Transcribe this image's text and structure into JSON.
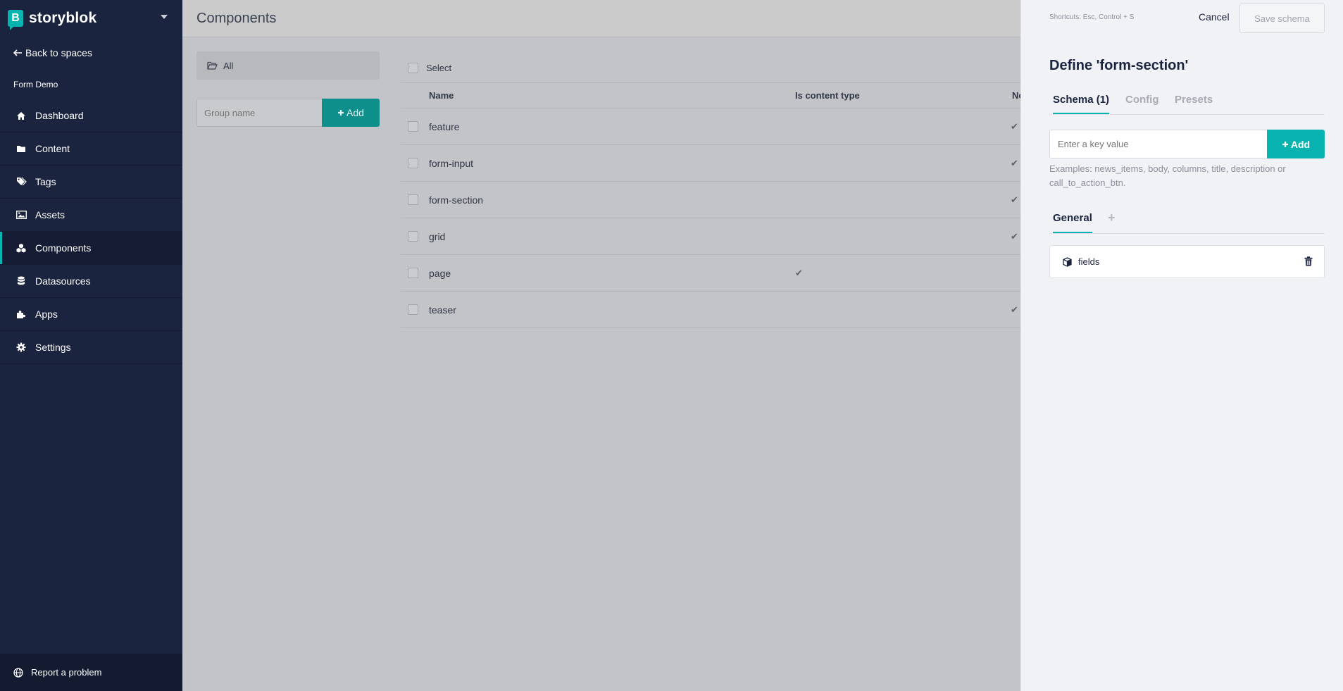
{
  "sidebar": {
    "brand": "storyblok",
    "back_label": "Back to spaces",
    "space_name": "Form Demo",
    "nav": [
      {
        "label": "Dashboard",
        "icon": "home-icon"
      },
      {
        "label": "Content",
        "icon": "folder-icon"
      },
      {
        "label": "Tags",
        "icon": "tags-icon"
      },
      {
        "label": "Assets",
        "icon": "image-icon"
      },
      {
        "label": "Components",
        "icon": "cubes-icon",
        "active": true
      },
      {
        "label": "Datasources",
        "icon": "database-icon"
      },
      {
        "label": "Apps",
        "icon": "puzzle-icon"
      },
      {
        "label": "Settings",
        "icon": "gear-icon"
      }
    ],
    "report_label": "Report a problem"
  },
  "main": {
    "title": "Components",
    "folder_all": "All",
    "group_placeholder": "Group name",
    "group_add_label": "Add",
    "select_label": "Select",
    "columns": {
      "name": "Name",
      "content_type": "Is content type",
      "nestable": "Ne"
    },
    "rows": [
      {
        "name": "feature",
        "content_type": false,
        "nestable": true
      },
      {
        "name": "form-input",
        "content_type": false,
        "nestable": true
      },
      {
        "name": "form-section",
        "content_type": false,
        "nestable": true
      },
      {
        "name": "grid",
        "content_type": false,
        "nestable": true
      },
      {
        "name": "page",
        "content_type": true,
        "nestable": false
      },
      {
        "name": "teaser",
        "content_type": false,
        "nestable": true
      }
    ]
  },
  "panel": {
    "shortcuts": "Shortcuts: Esc, Control + S",
    "cancel_label": "Cancel",
    "save_label": "Save schema",
    "title": "Define 'form-section'",
    "tabs": [
      "Schema (1)",
      "Config",
      "Presets"
    ],
    "key_placeholder": "Enter a key value",
    "key_add_label": "Add",
    "examples": "Examples: news_items, body, columns, title, description or call_to_action_btn.",
    "group_tab": "General",
    "fields": [
      {
        "name": "fields"
      }
    ]
  },
  "colors": {
    "accent": "#09b3af",
    "sidebar_bg": "#1b243f",
    "panel_bg": "#f1f2f5"
  }
}
